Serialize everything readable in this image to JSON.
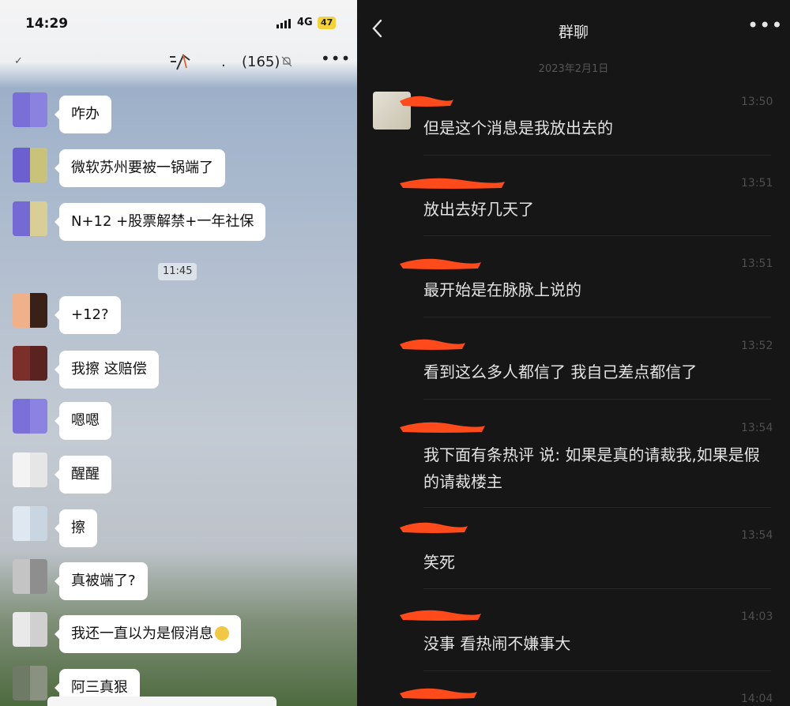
{
  "left_panel": {
    "status": {
      "time": "14:29",
      "network": "4G",
      "battery": "47"
    },
    "header": {
      "separator": ".",
      "member_count": "(165)"
    },
    "messages": [
      {
        "text": "咋办",
        "avatar_colors": [
          "#7a6fd6",
          "#8b82e0"
        ]
      },
      {
        "text": "微软苏州要被一锅端了",
        "avatar_colors": [
          "#6c5fcf",
          "#c9c27b"
        ]
      },
      {
        "text": "N+12 +股票解禁+一年社保",
        "avatar_colors": [
          "#7569d3",
          "#d9cf96"
        ]
      },
      {
        "text": "+12?",
        "avatar_colors": [
          "#f0b08a",
          "#3a2118"
        ]
      },
      {
        "text": "我擦 这赔偿",
        "avatar_colors": [
          "#7a2f2a",
          "#5a2320"
        ]
      },
      {
        "text": "嗯嗯",
        "avatar_colors": [
          "#7b70d8",
          "#8c82e1"
        ]
      },
      {
        "text": "醒醒",
        "avatar_colors": [
          "#f3f3f3",
          "#e6e6e6"
        ]
      },
      {
        "text": "擦",
        "avatar_colors": [
          "#dfe8f0",
          "#c9d6e2"
        ]
      },
      {
        "text": "真被端了?",
        "avatar_colors": [
          "#c4c4c4",
          "#8e8e8e"
        ]
      },
      {
        "text": "我还一直以为是假消息",
        "avatar_colors": [
          "#e9e9e9",
          "#d0d0d0"
        ],
        "emoji": "laughing-emoji"
      },
      {
        "text": "阿三真狠",
        "avatar_colors": [
          "#6f7a66",
          "#8a9180"
        ]
      }
    ],
    "time_divider": "11:45"
  },
  "right_panel": {
    "title": "群聊",
    "date": "2023年2月1日",
    "messages": [
      {
        "time": "13:50",
        "text": "但是这个消息是我放出去的"
      },
      {
        "time": "13:51",
        "text": "放出去好几天了"
      },
      {
        "time": "13:51",
        "text": "最开始是在脉脉上说的"
      },
      {
        "time": "13:52",
        "text": "看到这么多人都信了 我自己差点都信了"
      },
      {
        "time": "13:54",
        "text": "我下面有条热评 说: 如果是真的请裁我,如果是假的请裁楼主"
      },
      {
        "time": "13:54",
        "text": "笑死"
      },
      {
        "time": "14:03",
        "text": "没事 看热闹不嫌事大"
      },
      {
        "time": "14:04",
        "text": ""
      }
    ],
    "redaction_color": "#ff4a1c"
  }
}
